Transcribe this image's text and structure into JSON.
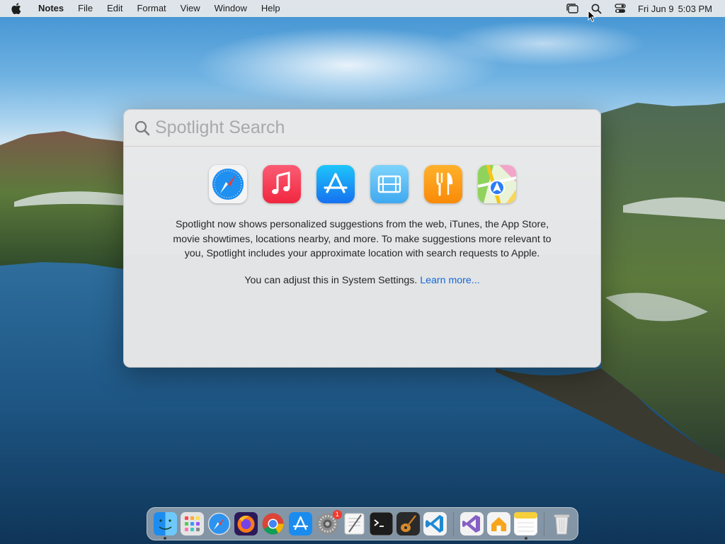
{
  "menubar": {
    "app_name": "Notes",
    "items": [
      "File",
      "Edit",
      "Format",
      "View",
      "Window",
      "Help"
    ],
    "clock_day": "Fri Jun 9",
    "clock_time": "5:03 PM",
    "status_icons": [
      "stage-manager-icon",
      "spotlight-search-icon",
      "control-center-icon"
    ]
  },
  "spotlight": {
    "placeholder": "Spotlight Search",
    "suggested_apps": [
      "Safari",
      "Music",
      "App Store",
      "TV",
      "Maps Food",
      "Maps"
    ],
    "info_text": "Spotlight now shows personalized suggestions from the web, iTunes, the App Store, movie showtimes, locations nearby, and more. To make suggestions more relevant to you, Spotlight includes your approximate location with search requests to Apple.",
    "settings_text": "You can adjust this in System Settings.",
    "learn_more": "Learn more..."
  },
  "dock": {
    "system_settings_badge": "1",
    "items": [
      "Finder",
      "Launchpad",
      "Safari",
      "Firefox",
      "Chrome",
      "App Store",
      "System Settings",
      "TextEdit",
      "Terminal",
      "Instruments",
      "Visual Studio Code",
      "Visual Studio",
      "Home",
      "Notes",
      "Trash"
    ]
  },
  "colors": {
    "link": "#1568d3",
    "menubar": "#ececec",
    "panel": "#e8e8e8"
  }
}
